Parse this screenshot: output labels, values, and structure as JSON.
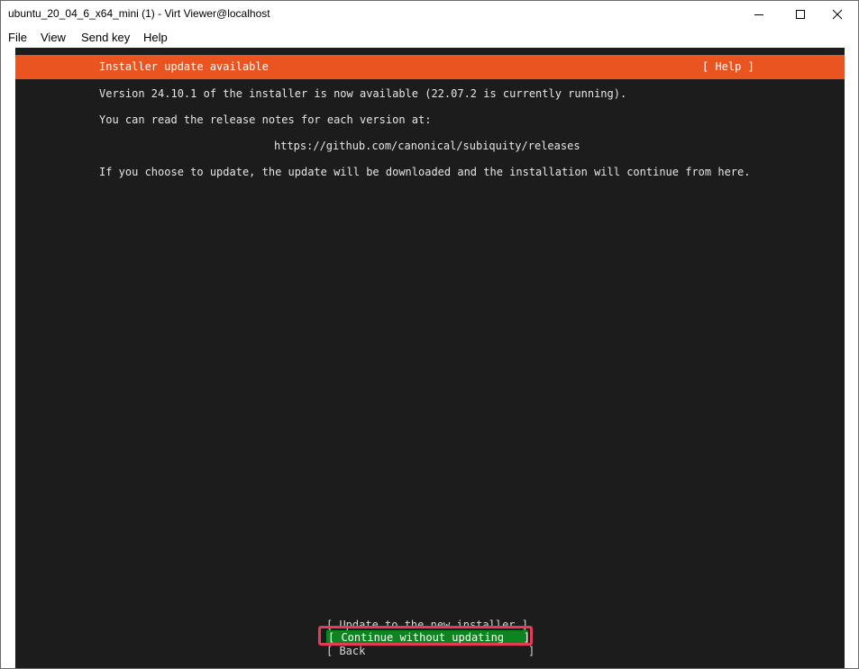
{
  "window": {
    "title": "ubuntu_20_04_6_x64_mini (1) - Virt Viewer@localhost"
  },
  "menubar": {
    "items": [
      "File",
      "View",
      "Send key",
      "Help"
    ]
  },
  "installer": {
    "header_title": "Installer update available",
    "help_label": "[ Help ]",
    "lines": [
      "Version 24.10.1 of the installer is now available (22.07.2 is currently running).",
      "You can read the release notes for each version at:",
      "https://github.com/canonical/subiquity/releases",
      "If you choose to update, the update will be downloaded and the installation will continue from here."
    ],
    "buttons": {
      "update": "[ Update to the new installer ]",
      "continue": "[ Continue without updating   ]",
      "back": "[ Back                         ]"
    }
  },
  "colors": {
    "ubuntu_orange": "#e95420",
    "focus_green": "#0e8420",
    "console_bg": "#1c1c1c",
    "highlight_red": "#e63b57"
  }
}
